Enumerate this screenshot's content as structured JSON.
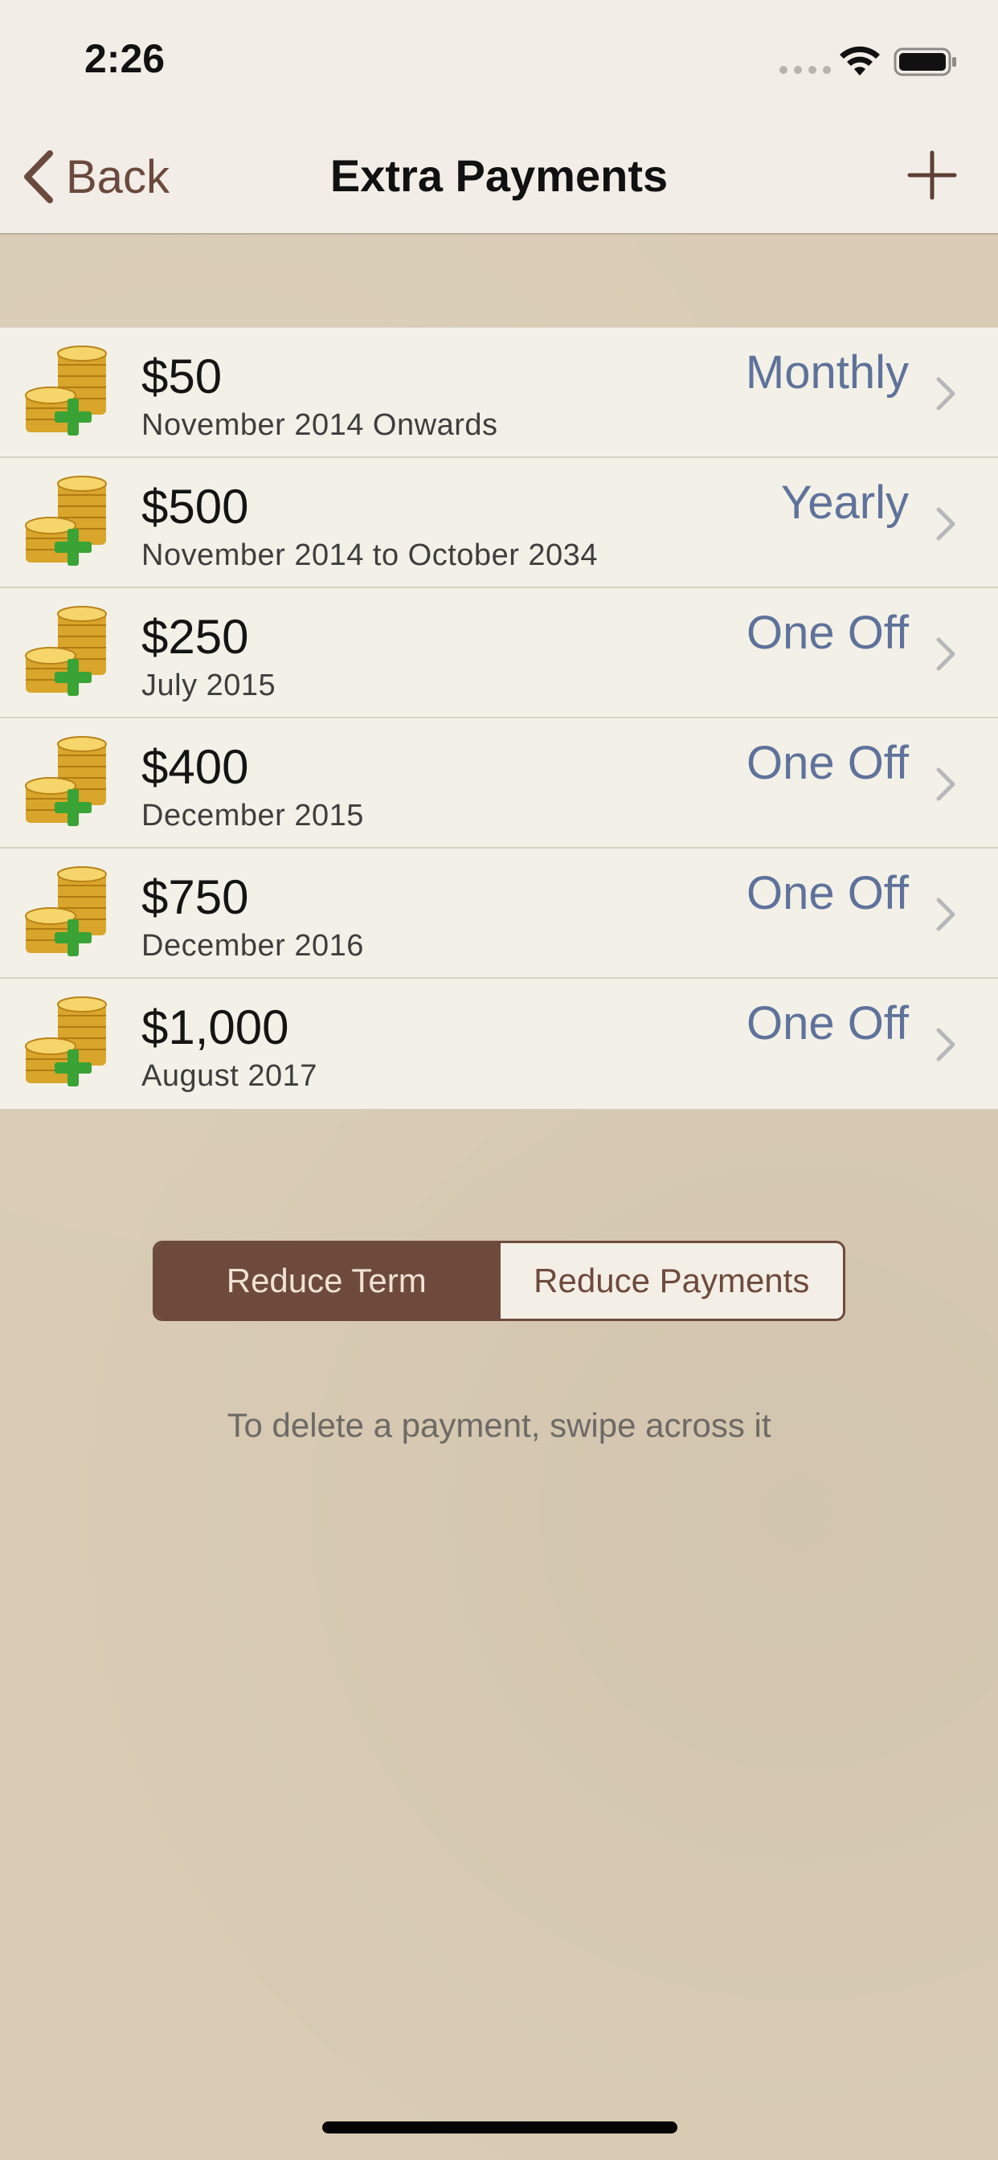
{
  "status_bar": {
    "time": "2:26"
  },
  "nav": {
    "back_label": "Back",
    "title": "Extra Payments"
  },
  "payments": [
    {
      "amount": "$50",
      "period": "November 2014 Onwards",
      "frequency": "Monthly"
    },
    {
      "amount": "$500",
      "period": "November 2014 to October 2034",
      "frequency": "Yearly"
    },
    {
      "amount": "$250",
      "period": "July 2015",
      "frequency": "One Off"
    },
    {
      "amount": "$400",
      "period": "December 2015",
      "frequency": "One Off"
    },
    {
      "amount": "$750",
      "period": "December 2016",
      "frequency": "One Off"
    },
    {
      "amount": "$1,000",
      "period": "August 2017",
      "frequency": "One Off"
    }
  ],
  "segmented": {
    "options": [
      "Reduce Term",
      "Reduce Payments"
    ],
    "selected": "Reduce Term"
  },
  "hint": "To delete a payment, swipe across it",
  "colors": {
    "accent_brown": "#6e4a3d",
    "frequency_blue": "#5f729b",
    "list_background": "#f3f1e7",
    "page_background": "#d9cbb4"
  },
  "icons": {
    "row_icon": "gold-coins-plus-icon",
    "row_disclosure": "chevron-right-icon",
    "add": "plus-icon",
    "back": "chevron-left-icon"
  }
}
